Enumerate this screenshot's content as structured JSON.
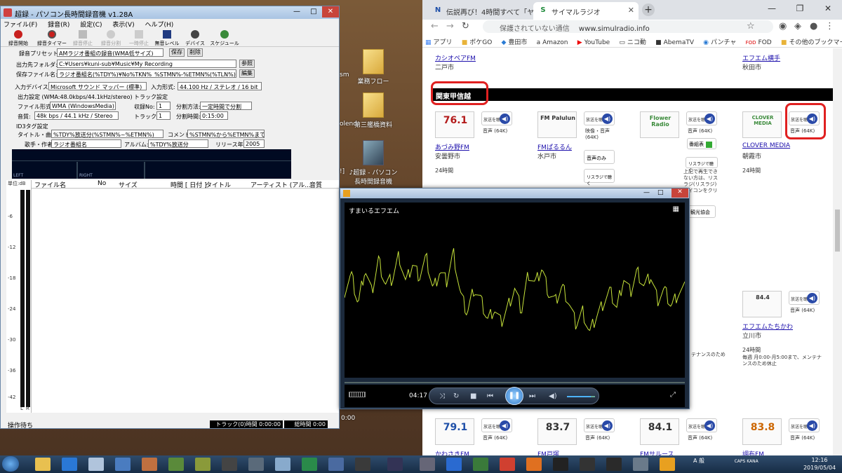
{
  "choroku": {
    "title": "超録 - パソコン長時間録音機 v1.28A",
    "menu": [
      "ファイル(F)",
      "録音(R)",
      "設定(C)",
      "表示(V)",
      "ヘルプ(H)"
    ],
    "toolbar": [
      "録音開始",
      "録音タイマー",
      "録音停止",
      "録音分割",
      "一時停止",
      "無音レベル",
      "デバイス",
      "スケジュール"
    ],
    "preset_label": "録音プリセット:",
    "preset_value": "AMラジオ番組の録音(WMA低サイズ)",
    "save": "保存",
    "delete": "削除",
    "folder_label": "出力先フォルダ:",
    "folder_value": "C:¥Users¥kuni-sub¥Music¥My Recording",
    "browse": "参照",
    "filename_label": "保存ファイル名:",
    "filename_value": "ラジオ番組名(%TDY%)¥No%TKN%_%STMN%-%ETMN%(%TLN%).wma",
    "edit": "編集",
    "input_device_label": "入力デバイス:",
    "input_device_value": "Microsoft サウンド マッパー (標準)",
    "input_format_label": "入力形式:",
    "input_format_value": "44.100 Hz / ステレオ / 16 bit",
    "output_settings_label": "出力設定 (WMA:48.0kbps/44.1kHz/stereo)",
    "file_format_label": "ファイル形式:",
    "file_format_value": "WMA (WindowsMedia)",
    "quality_label": "音質:",
    "quality_value": "48k bps / 44.1 kHz / Stereo",
    "track_label": "トラック設定",
    "rec_no_label": "収録No:",
    "rec_no_value": "1",
    "track_no_label": "トラックNo:",
    "track_no_value": "1",
    "split_method_label": "分割方法:",
    "split_method_value": "一定時間で分割",
    "split_time_label": "分割時間:",
    "split_time_value": "0:15:00",
    "id3_label": "ID3タグ設定",
    "title_label": "タイトル・曲名:",
    "title_value": "%TDY%放送分(%STMN%~%ETMN%)",
    "comment_label": "コメント:",
    "comment_value": "%STMN%から%ETMN%まで(%TLN%の",
    "artist_label": "歌手・作者:",
    "artist_value": "ラジオ番組名",
    "album_label": "アルバム:",
    "album_value": "%TDY%放送分",
    "year_label": "リリース年:",
    "year_value": "2005",
    "meter_left": "LEFT",
    "meter_right": "RIGHT",
    "db_unit": "単位:dB",
    "db_ticks": [
      "-6",
      "-12",
      "-18",
      "-24",
      "-30",
      "-36",
      "-42"
    ],
    "lr": [
      "L",
      "R"
    ],
    "list_headers": [
      "ファイル名",
      "No",
      "サイズ",
      "時間 [ 日付 ]",
      "タイトル",
      "アーティスト (アル...",
      "音質"
    ],
    "status": "操作待ち",
    "track_time": "トラック(0)時間 0:00:00",
    "total_time": "総時間 0:00"
  },
  "desktop": {
    "icons": [
      "業務フロー",
      "第三艦橋資料",
      "♪超録 - パソコン長時間録音機"
    ],
    "edge_labels": [
      "sm",
      "olend",
      "!]",
      "0:00"
    ]
  },
  "browser": {
    "tabs": [
      "伝説再び！4時間すべて「ヤマト",
      "サイマルラジオ"
    ],
    "tab_icons": [
      "N",
      "S"
    ],
    "url_security": "保護されていない通信",
    "url": "www.simulradio.info",
    "bookmarks": [
      "アプリ",
      "ポケGO",
      "豊田市",
      "Amazon",
      "YouTube",
      "ニコ動",
      "AbemaTV",
      "パンチャ",
      "FOD",
      "その他のブックマーク"
    ],
    "top_stations": [
      {
        "name": "カシオペアFM",
        "city": "二戸市"
      },
      {
        "name": "エフエム横手",
        "city": "秋田市"
      }
    ],
    "region": "関東甲信越",
    "listen_label": "放送を聴く",
    "stations": [
      {
        "name": "あづみ野FM",
        "city": "安曇野市",
        "hours": "24時間",
        "quality": "音声 (64K)",
        "logo": "76.1"
      },
      {
        "name": "FMぱるるん",
        "city": "水戸市",
        "hours": "",
        "quality": "映像・音声 (64K)",
        "logo": "FM Palulun"
      },
      {
        "name": "フラワーラジオ",
        "city": "",
        "hours": "",
        "quality": "音声 (64K)",
        "logo": "Flower Radio"
      },
      {
        "name": "CLOVER MEDIA",
        "city": "朝霞市",
        "hours": "24時間",
        "quality": "音声 (64K)",
        "logo": "CLOVER MEDIA"
      },
      {
        "name": "エフエムたちかわ",
        "city": "立川市",
        "hours": "24時間",
        "quality": "音声 (64K)",
        "logo": "84.4"
      },
      {
        "name": "かわさきFM",
        "city": "",
        "hours": "",
        "quality": "音声 (64K)",
        "logo": "79.1"
      },
      {
        "name": "FM戸塚",
        "city": "",
        "hours": "",
        "quality": "音声 (64K)",
        "logo": "83.7"
      },
      {
        "name": "FMサルース",
        "city": "",
        "hours": "",
        "quality": "音声 (64K)",
        "logo": "84.1"
      },
      {
        "name": "調布FM",
        "city": "",
        "hours": "",
        "quality": "音声 (64K)",
        "logo": "83.8"
      }
    ],
    "partial_texts": [
      "番組表",
      "上記で再生できない方は、リスラジ(リスラジ)アイコンをクリックしてご確認ください",
      "観光協会",
      "毎週 月0:00-月5:00まで、メンテナンスのため休止",
      "テナンスのため",
      "音声のみ",
      "リスラジで聴く"
    ]
  },
  "wmp": {
    "station_title": "すまいるエフエム",
    "time": "04:17",
    "wave": [
      0.08,
      0.32,
      -0.12,
      0.42,
      0.05,
      0.55,
      0.18,
      0.25,
      0.62,
      0.2,
      0.48,
      0.3,
      0.58,
      0.1,
      0.38,
      0.22,
      0.66,
      0.05,
      -0.25,
      0.12,
      -0.05,
      -0.35,
      -0.18,
      -0.4,
      -0.15,
      0.12,
      -0.22,
      0.35,
      0.18,
      0.42,
      0.05,
      -0.08,
      0.15,
      -0.1,
      -0.42,
      -0.22,
      -0.55,
      -0.3,
      -0.1,
      0.08,
      -0.18,
      0.28,
      0.05,
      0.38,
      0.15,
      0.3,
      -0.05,
      0.1,
      -0.15,
      0.05,
      0.12
    ]
  },
  "taskbar": {
    "ime": "A 般",
    "caps": "CAPS KANA",
    "time": "12:16",
    "date": "2019/05/04"
  }
}
